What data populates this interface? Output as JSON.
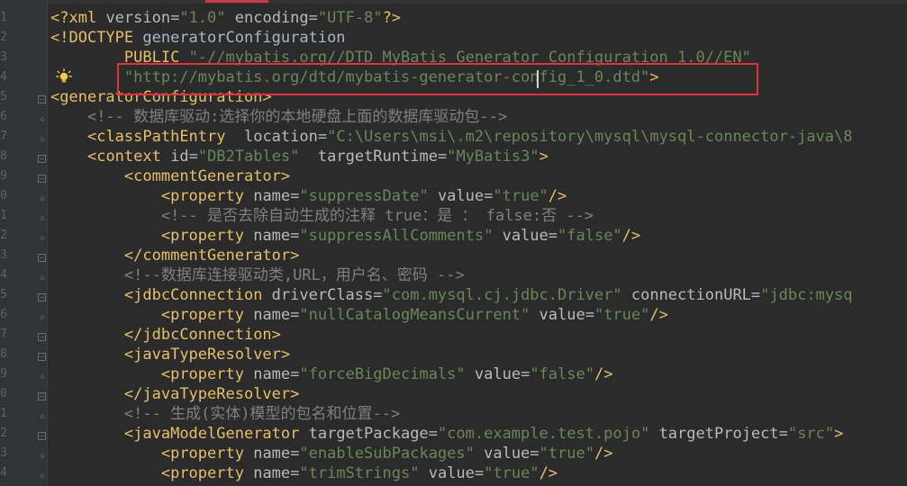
{
  "gutter": {
    "line_numbers": [
      "1",
      "2",
      "3",
      "4",
      "5",
      "6",
      "7",
      "8",
      "9",
      "0",
      "1",
      "2",
      "3",
      "4",
      "5",
      "6",
      "7",
      "8",
      "9",
      "0",
      "1",
      "2",
      "3",
      "4"
    ]
  },
  "code": {
    "l1": {
      "p1": "<?",
      "tag": "xml",
      "a1": " version",
      "eq1": "=",
      "v1": "\"1.0\"",
      "a2": " encoding",
      "eq2": "=",
      "v2": "\"UTF-8\"",
      "p2": "?>"
    },
    "l2": {
      "p1": "<!",
      "kw": "DOCTYPE",
      "rest": " generatorConfiguration"
    },
    "l3": {
      "indent": "        ",
      "kw": "PUBLIC",
      "sp": " ",
      "v": "\"-//mybatis.org//DTD MyBatis Generator Configuration 1.0//EN\""
    },
    "l4": {
      "indent": "        ",
      "v": "\"http://mybatis.org/dtd/mybatis-generator-config_1_0.dtd\"",
      "p": ">"
    },
    "l5": {
      "open": "<",
      "tag": "generatorConfiguration",
      "close": ">"
    },
    "l6": {
      "indent": "    ",
      "comment": "<!-- 数据库驱动:选择你的本地硬盘上面的数据库驱动包-->"
    },
    "l7": {
      "indent": "    ",
      "open": "<",
      "tag": "classPathEntry",
      "a1": "  location",
      "eq": "=",
      "v": "\"C:\\Users\\msi\\.m2\\repository\\mysql\\mysql-connector-java\\8"
    },
    "l8": {
      "indent": "    ",
      "open": "<",
      "tag": "context",
      "a1": " id",
      "eq1": "=",
      "v1": "\"DB2Tables\"",
      "a2": "  targetRuntime",
      "eq2": "=",
      "v2": "\"MyBatis3\"",
      "close": ">"
    },
    "l9": {
      "indent": "        ",
      "open": "<",
      "tag": "commentGenerator",
      "close": ">"
    },
    "l10": {
      "indent": "            ",
      "open": "<",
      "tag": "property",
      "a1": " name",
      "eq1": "=",
      "v1": "\"suppressDate\"",
      "a2": " value",
      "eq2": "=",
      "v2": "\"true\"",
      "close": "/>"
    },
    "l11": {
      "indent": "            ",
      "comment": "<!-- 是否去除自动生成的注释 true：是 ： false:否 -->"
    },
    "l12": {
      "indent": "            ",
      "open": "<",
      "tag": "property",
      "a1": " name",
      "eq1": "=",
      "v1": "\"suppressAllComments\"",
      "a2": " value",
      "eq2": "=",
      "v2": "\"false\"",
      "close": "/>"
    },
    "l13": {
      "indent": "        ",
      "open": "</",
      "tag": "commentGenerator",
      "close": ">"
    },
    "l14": {
      "indent": "        ",
      "comment": "<!--数据库连接驱动类,URL，用户名、密码 -->"
    },
    "l15": {
      "indent": "        ",
      "open": "<",
      "tag": "jdbcConnection",
      "a1": " driverClass",
      "eq1": "=",
      "v1": "\"com.mysql.cj.jdbc.Driver\"",
      "a2": " connectionURL",
      "eq2": "=",
      "v2": "\"jdbc:mysq"
    },
    "l16": {
      "indent": "            ",
      "open": "<",
      "tag": "property",
      "a1": " name",
      "eq1": "=",
      "v1": "\"nullCatalogMeansCurrent\"",
      "a2": " value",
      "eq2": "=",
      "v2": "\"true\"",
      "close": "/>"
    },
    "l17": {
      "indent": "        ",
      "open": "</",
      "tag": "jdbcConnection",
      "close": ">"
    },
    "l18": {
      "indent": "        ",
      "open": "<",
      "tag": "javaTypeResolver",
      "close": ">"
    },
    "l19": {
      "indent": "            ",
      "open": "<",
      "tag": "property",
      "a1": " name",
      "eq1": "=",
      "v1": "\"forceBigDecimals\"",
      "a2": " value",
      "eq2": "=",
      "v2": "\"false\"",
      "close": "/>"
    },
    "l20": {
      "indent": "        ",
      "open": "</",
      "tag": "javaTypeResolver",
      "close": ">"
    },
    "l21": {
      "indent": "        ",
      "comment": "<!-- 生成(实体)模型的包名和位置-->"
    },
    "l22": {
      "indent": "        ",
      "open": "<",
      "tag": "javaModelGenerator",
      "a1": " targetPackage",
      "eq1": "=",
      "v1": "\"com.example.test.pojo\"",
      "a2": " targetProject",
      "eq2": "=",
      "v2": "\"src\"",
      "close": ">"
    },
    "l23": {
      "indent": "            ",
      "open": "<",
      "tag": "property",
      "a1": " name",
      "eq1": "=",
      "v1": "\"enableSubPackages\"",
      "a2": " value",
      "eq2": "=",
      "v2": "\"true\"",
      "close": "/>"
    },
    "l24": {
      "indent": "            ",
      "open": "<",
      "tag": "property",
      "a1": " name",
      "eq1": "=",
      "v1": "\"trimStrings\"",
      "a2": " value",
      "eq2": "=",
      "v2": "\"true\"",
      "close": "/>"
    }
  },
  "colors": {
    "background": "#2b2b2b",
    "tag": "#e8bf6a",
    "attribute": "#bababa",
    "string": "#6a8759",
    "comment": "#808080",
    "keyword": "#cc7832",
    "highlight_box": "#e0323c"
  },
  "icons": {
    "intention": "lightbulb-icon"
  }
}
